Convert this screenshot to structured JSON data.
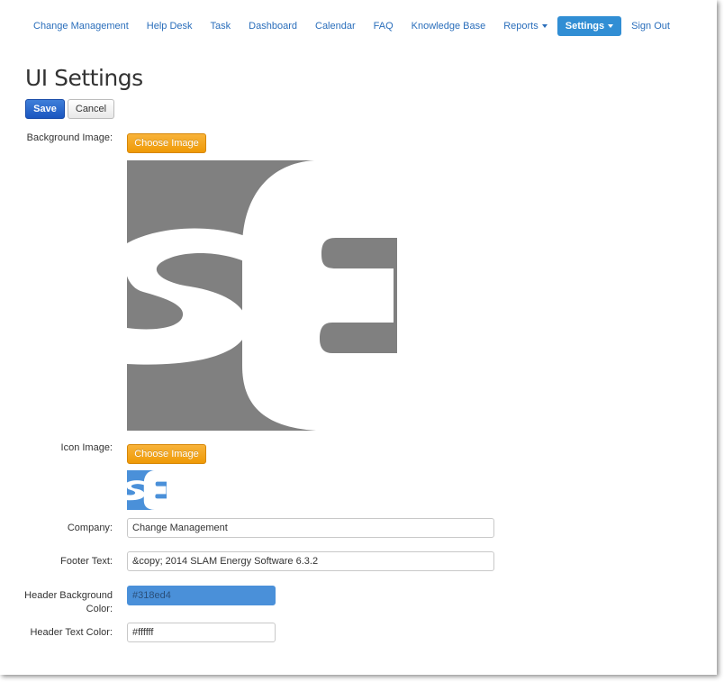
{
  "nav": {
    "items": [
      {
        "label": "Change Management"
      },
      {
        "label": "Help Desk"
      },
      {
        "label": "Task"
      },
      {
        "label": "Dashboard"
      },
      {
        "label": "Calendar"
      },
      {
        "label": "FAQ"
      },
      {
        "label": "Knowledge Base"
      },
      {
        "label": "Reports",
        "dropdown": true
      },
      {
        "label": "Settings",
        "dropdown": true,
        "active": true
      },
      {
        "label": "Sign Out"
      }
    ]
  },
  "page": {
    "title": "UI Settings",
    "save_label": "Save",
    "cancel_label": "Cancel"
  },
  "form": {
    "background_image": {
      "label": "Background Image:",
      "button_label": "Choose Image",
      "preview_color": "#808080"
    },
    "icon_image": {
      "label": "Icon Image:",
      "button_label": "Choose Image",
      "preview_color": "#4a90d9"
    },
    "company": {
      "label": "Company:",
      "value": "Change Management"
    },
    "footer_text": {
      "label": "Footer Text:",
      "value": "&copy; 2014 SLAM Energy Software 6.3.2"
    },
    "header_bg_color": {
      "label_line1": "Header Background",
      "label_line2": "Color:",
      "value": "#318ed4"
    },
    "header_text_color": {
      "label": "Header Text Color:",
      "value": "#ffffff"
    }
  },
  "colors": {
    "accent": "#318ed4",
    "link": "#2a6ebb",
    "save_button": "#1b56c0",
    "choose_button": "#ef9a06"
  }
}
